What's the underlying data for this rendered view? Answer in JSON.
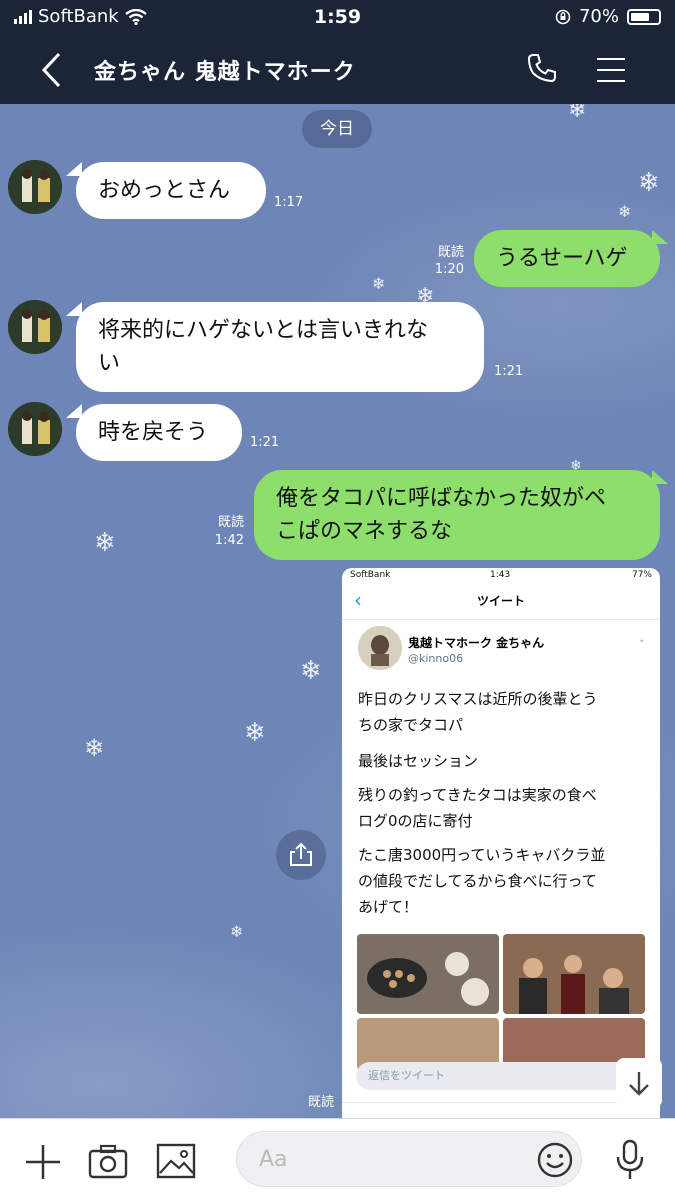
{
  "status": {
    "carrier": "SoftBank",
    "time": "1:59",
    "battery": "70%",
    "battery_level": 0.7
  },
  "header": {
    "back_icon": "chevron-left-icon",
    "title": "金ちゃん 鬼越トマホーク",
    "call_icon": "phone-icon",
    "menu_icon": "hamburger-icon"
  },
  "date_label": "今日",
  "messages": [
    {
      "side": "in",
      "text_lines": [
        "おめっとさん"
      ],
      "time": "1:17"
    },
    {
      "side": "out",
      "text_lines": [
        "うるせーハゲ"
      ],
      "read": "既読",
      "time": "1:20"
    },
    {
      "side": "in",
      "text_lines": [
        "将来的にハゲないとは言いきれな",
        "い"
      ],
      "time": "1:21"
    },
    {
      "side": "in",
      "text_lines": [
        "時を戻そう"
      ],
      "time": "1:21"
    },
    {
      "side": "out",
      "text_lines": [
        "俺をタコパに呼ばなかった奴がペ",
        "こぱのマネするな"
      ],
      "read": "既読",
      "time": "1:42"
    }
  ],
  "image_message": {
    "read": "既読",
    "status": {
      "carrier": "SoftBank",
      "time": "1:43",
      "battery": "77%"
    },
    "nav_title": "ツイート",
    "name": "鬼越トマホーク 金ちゃん",
    "handle": "@kinno06",
    "lines": [
      "昨日のクリスマスは近所の後輩とう",
      "ちの家でタコパ",
      "最後はセッション",
      "残りの釣ってきたタコは実家の食べ",
      "ログ0の店に寄付",
      "たこ唐3000円っていうキャバクラ並",
      "の値段でだしてるから食べに行って",
      "あげて！"
    ],
    "reply_placeholder": "返信をツイート"
  },
  "composer": {
    "placeholder": "Aa",
    "plus_icon": "plus-icon",
    "camera_icon": "camera-icon",
    "image_icon": "image-icon",
    "emoji_icon": "emoji-icon",
    "mic_icon": "mic-icon"
  },
  "colors": {
    "header_bg": "#1c2538",
    "chat_bg": "#6e86b7",
    "out_bubble": "#8ede6b",
    "in_bubble": "#ffffff"
  }
}
